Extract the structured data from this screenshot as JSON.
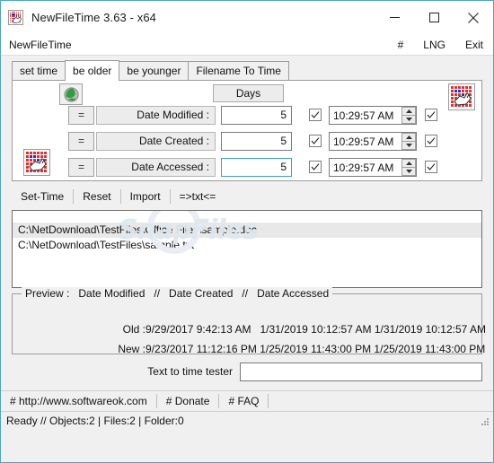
{
  "window": {
    "title": "NewFileTime 3.63 - x64",
    "app_icon": "file-time-grid-icon",
    "minimize_label": "minimize-icon",
    "maximize_label": "maximize-icon",
    "close_label": "close-icon",
    "accent_border": "#4aa8c4"
  },
  "menu": {
    "app_name": "NewFileTime",
    "hash": "#",
    "lng": "LNG",
    "exit": "Exit"
  },
  "tabs": [
    {
      "label": "set time",
      "active": false
    },
    {
      "label": "be older",
      "active": true
    },
    {
      "label": "be younger",
      "active": false
    },
    {
      "label": "Filename To Time",
      "active": false
    }
  ],
  "form": {
    "globe_icon": "globe-icon",
    "days_header": "Days",
    "top_right_icon": "file-time-grid-icon",
    "bottom_left_icon": "file-time-grid-icon",
    "rows": [
      {
        "op": "=",
        "label": "Date Modified :",
        "days": "5",
        "days_focused": false,
        "days_checkbox": true,
        "time": "10:29:57 AM",
        "time_checkbox": true
      },
      {
        "op": "=",
        "label": "Date Created :",
        "days": "5",
        "days_focused": false,
        "days_checkbox": true,
        "time": "10:29:57 AM",
        "time_checkbox": true
      },
      {
        "op": "=",
        "label": "Date Accessed :",
        "days": "5",
        "days_focused": true,
        "days_checkbox": true,
        "time": "10:29:57 AM",
        "time_checkbox": true
      }
    ]
  },
  "actions": [
    {
      "label": "Set-Time"
    },
    {
      "label": "Reset"
    },
    {
      "label": "Import"
    },
    {
      "label": "=>txt<="
    }
  ],
  "filelist": {
    "watermark": "SnapFiles",
    "items": [
      {
        "path": "C:\\NetDownload\\TestFiles\\Office Files\\sample.doc",
        "selected": true
      },
      {
        "path": "C:\\NetDownload\\TestFiles\\sample.txt",
        "selected": false
      }
    ]
  },
  "preview": {
    "legend": "Preview :   Date Modified   //   Date Created   //   Date Accessed",
    "old_label": "Old :",
    "old_values": "9/29/2017 9:42:13 AM   1/31/2019 10:12:57 AM 1/31/2019 10:12:57 AM",
    "new_label": "New :",
    "new_values": "9/23/2017 11:12:16 PM 1/25/2019 11:43:00 PM 1/25/2019 11:43:00 PM"
  },
  "tester": {
    "label": "Text to time tester",
    "value": "",
    "placeholder": ""
  },
  "links": [
    {
      "label": "# http://www.softwareok.com"
    },
    {
      "label": "# Donate"
    },
    {
      "label": "# FAQ"
    }
  ],
  "status": {
    "text": "Ready // Objects:2 | Files:2  | Folder:0"
  }
}
